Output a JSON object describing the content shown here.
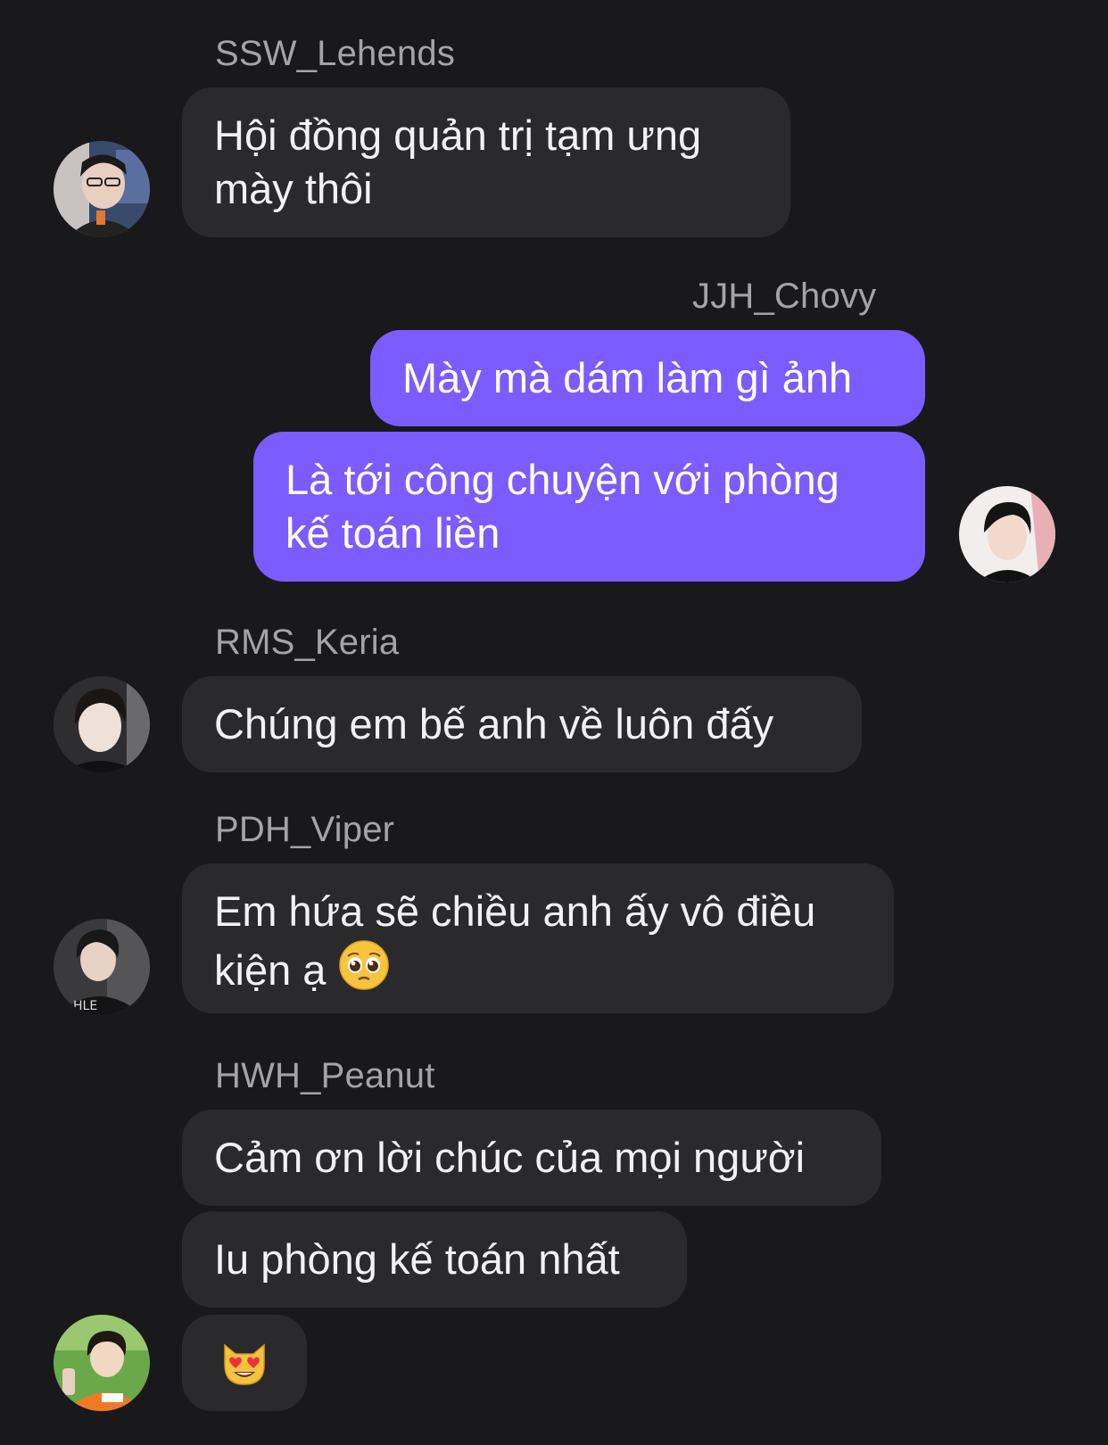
{
  "messages": [
    {
      "sender": "SSW_Lehends",
      "lines": [
        "Hội đồng quản trị tạm ưng",
        "mày thôi"
      ]
    },
    {
      "sender": "JJH_Chovy",
      "bubbles": [
        [
          "Mày mà dám làm gì ảnh"
        ],
        [
          "Là tới công chuyện với phòng",
          "kế toán liền"
        ]
      ]
    },
    {
      "sender": "RMS_Keria",
      "lines": [
        "Chúng em bế anh về luôn đấy"
      ]
    },
    {
      "sender": "PDH_Viper",
      "lines": [
        "Em hứa sẽ chiều anh ấy vô điều",
        "kiện ạ"
      ],
      "emoji": "pleading-face"
    },
    {
      "sender": "HWH_Peanut",
      "bubbles": [
        [
          "Cảm ơn lời chúc của mọi người"
        ],
        [
          "Iu phòng kế toán nhất"
        ]
      ],
      "emoji": "heart-eyes-cat"
    }
  ],
  "colors": {
    "background": "#19191b",
    "incoming_bubble": "#2a2a2d",
    "outgoing_bubble": "#7b5cff",
    "sender_name": "#a4a4a8",
    "message_text": "#f2f2f4"
  }
}
